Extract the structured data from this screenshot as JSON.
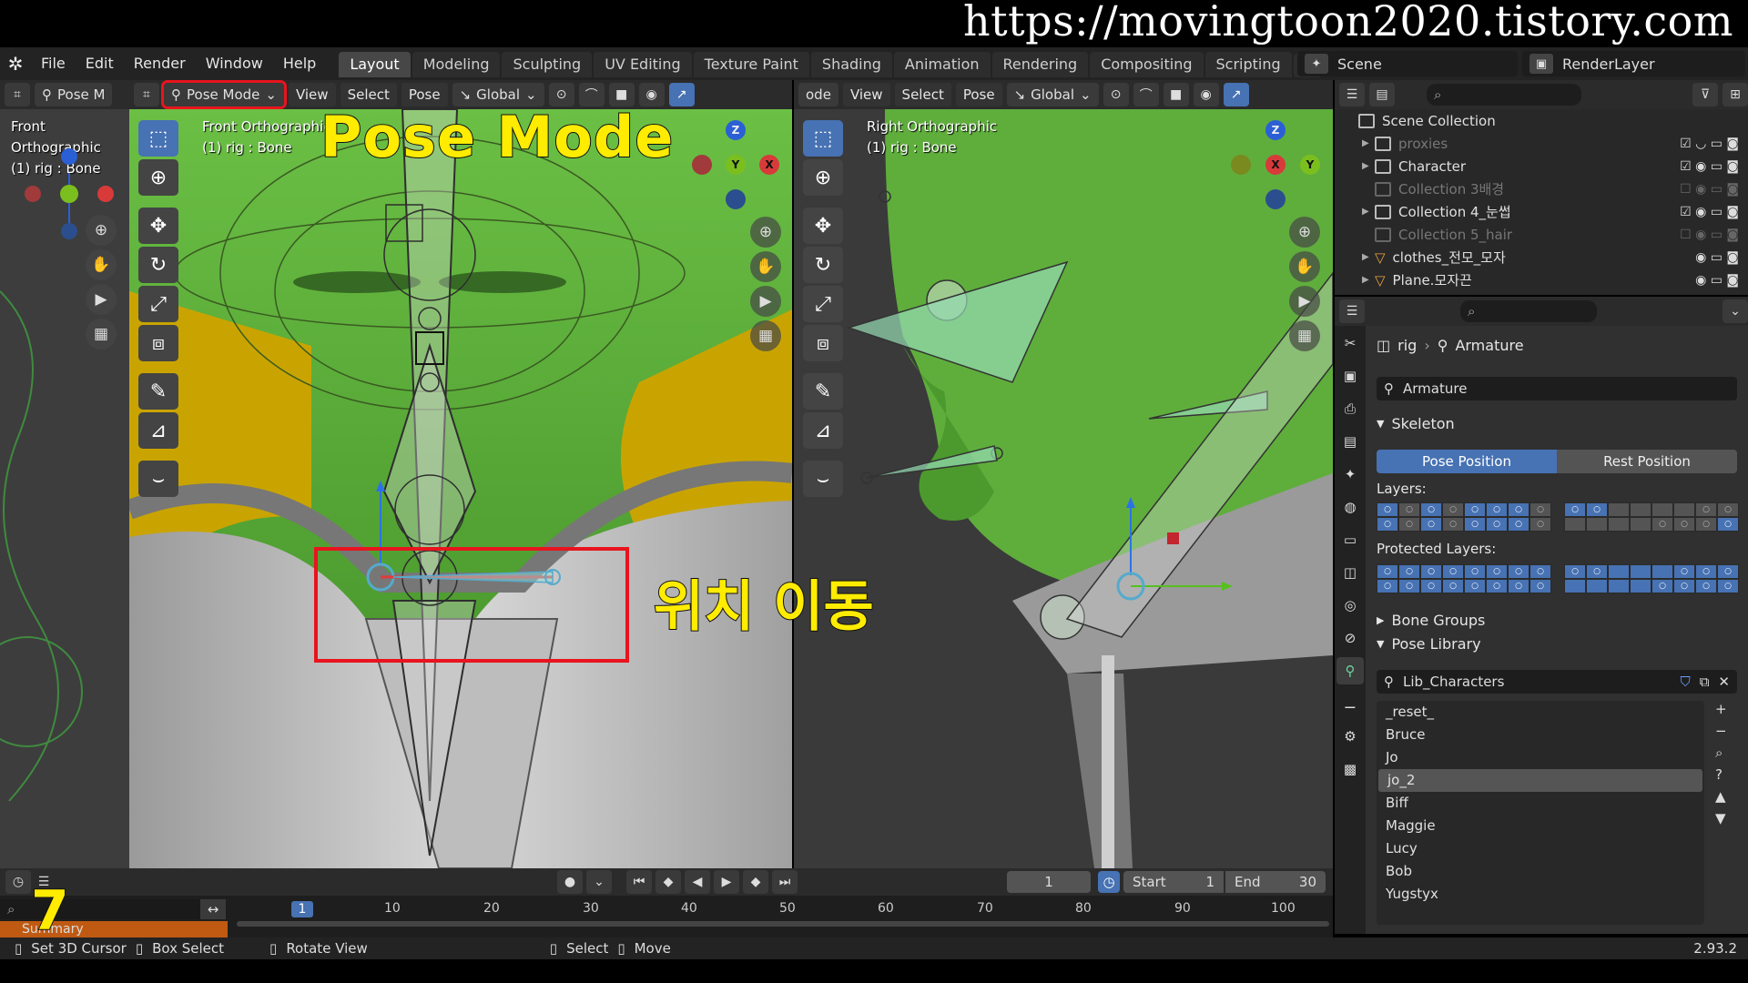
{
  "watermark": "https://movingtoon2020.tistory.com",
  "menubar": {
    "items": [
      "File",
      "Edit",
      "Render",
      "Window",
      "Help"
    ],
    "tabs": [
      "Layout",
      "Modeling",
      "Sculpting",
      "UV Editing",
      "Texture Paint",
      "Shading",
      "Animation",
      "Rendering",
      "Compositing",
      "Scripting"
    ],
    "active_tab": "Layout",
    "add": "+",
    "scene": "Scene",
    "render_layer": "RenderLayer"
  },
  "left_strip": {
    "mode": "Pose M",
    "title": "Front Orthographic",
    "subtitle": "(1) rig : Bone"
  },
  "viewport_left": {
    "mode": "Pose Mode",
    "menus": [
      "View",
      "Select",
      "Pose"
    ],
    "orientation": "Global",
    "title": "Front Orthographic",
    "subtitle": "(1) rig : Bone"
  },
  "viewport_right": {
    "mode_fragment": "ode",
    "menus": [
      "View",
      "Select",
      "Pose"
    ],
    "orientation": "Global",
    "title": "Right Orthographic",
    "subtitle": "(1) rig : Bone"
  },
  "annotations": {
    "pose_mode": "Pose Mode",
    "move_position": "위치 이동",
    "step_number": "7"
  },
  "outliner": {
    "root": "Scene Collection",
    "rows": [
      {
        "name": "proxies",
        "dim": true,
        "expand": true
      },
      {
        "name": "Character",
        "dim": false,
        "expand": true
      },
      {
        "name": "Collection 3배경",
        "dim": true,
        "expand": false
      },
      {
        "name": "Collection 4_눈썹",
        "dim": false,
        "expand": true
      },
      {
        "name": "Collection 5_hair",
        "dim": true,
        "expand": false
      },
      {
        "name": "clothes_전모_모자",
        "dim": false,
        "expand": true
      },
      {
        "name": "Plane.모자끈",
        "dim": false,
        "expand": true
      }
    ]
  },
  "properties": {
    "breadcrumb_object": "rig",
    "breadcrumb_data": "Armature",
    "data_name": "Armature",
    "skeleton_label": "Skeleton",
    "pose_position": "Pose Position",
    "rest_position": "Rest Position",
    "layers_label": "Layers:",
    "protected_layers_label": "Protected Layers:",
    "bone_groups": "Bone Groups",
    "pose_library": "Pose Library",
    "library_name": "Lib_Characters",
    "library_items": [
      "_reset_",
      "Bruce",
      "Jo",
      "jo_2",
      "Biff",
      "Maggie",
      "Lucy",
      "Bob",
      "Yugstyx"
    ],
    "selected_item": "jo_2"
  },
  "timeline": {
    "current_frame": "1",
    "start_label": "Start",
    "start": "1",
    "end_label": "End",
    "end": "30",
    "ruler": [
      "1",
      "10",
      "20",
      "30",
      "40",
      "50",
      "60",
      "70",
      "80",
      "90",
      "100"
    ],
    "summary": "Summary"
  },
  "statusbar": {
    "items": [
      "Set 3D Cursor",
      "Box Select",
      "Rotate View",
      "Select",
      "Move"
    ],
    "version": "2.93.2"
  },
  "colors": {
    "accent": "#4772b3",
    "highlight_box": "#e8141e",
    "annotation_text": "#ffec00",
    "skin_green": "#5fae3c"
  }
}
